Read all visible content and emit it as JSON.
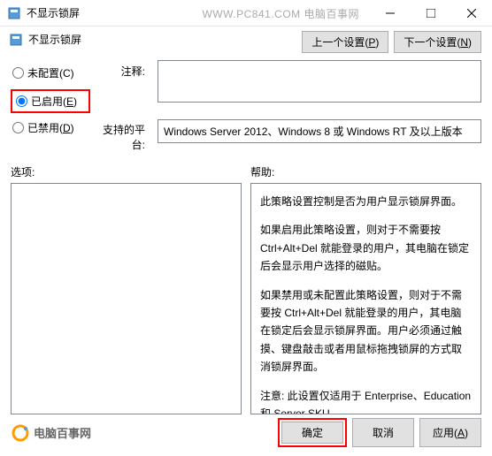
{
  "titlebar": {
    "title": "不显示锁屏"
  },
  "watermark": "WWW.PC841.COM 电脑百事网",
  "subtitle": "不显示锁屏",
  "nav": {
    "prev": "上一个设置(P)",
    "next": "下一个设置(N)"
  },
  "radios": {
    "not_configured": "未配置(C)",
    "enabled": "已启用(E)",
    "disabled": "已禁用(D)"
  },
  "labels": {
    "comment": "注释:",
    "platform": "支持的平台:",
    "options": "选项:",
    "help": "帮助:"
  },
  "platform_text": "Windows Server 2012、Windows 8 或 Windows RT 及以上版本",
  "help_lines": {
    "l1": "此策略设置控制是否为用户显示锁屏界面。",
    "l2": "如果启用此策略设置，则对于不需要按 Ctrl+Alt+Del 就能登录的用户，其电脑在锁定后会显示用户选择的磁贴。",
    "l3": "如果禁用或未配置此策略设置，则对于不需要按 Ctrl+Alt+Del 就能登录的用户，其电脑在锁定后会显示锁屏界面。用户必须通过触摸、键盘敲击或者用鼠标拖拽锁屏的方式取消锁屏界面。",
    "l4": "注意: 此设置仅适用于 Enterprise、Education 和 Server SKU。"
  },
  "footer": {
    "logo_text": "电脑百事网",
    "ok": "确定",
    "cancel": "取消",
    "apply": "应用(A)"
  }
}
